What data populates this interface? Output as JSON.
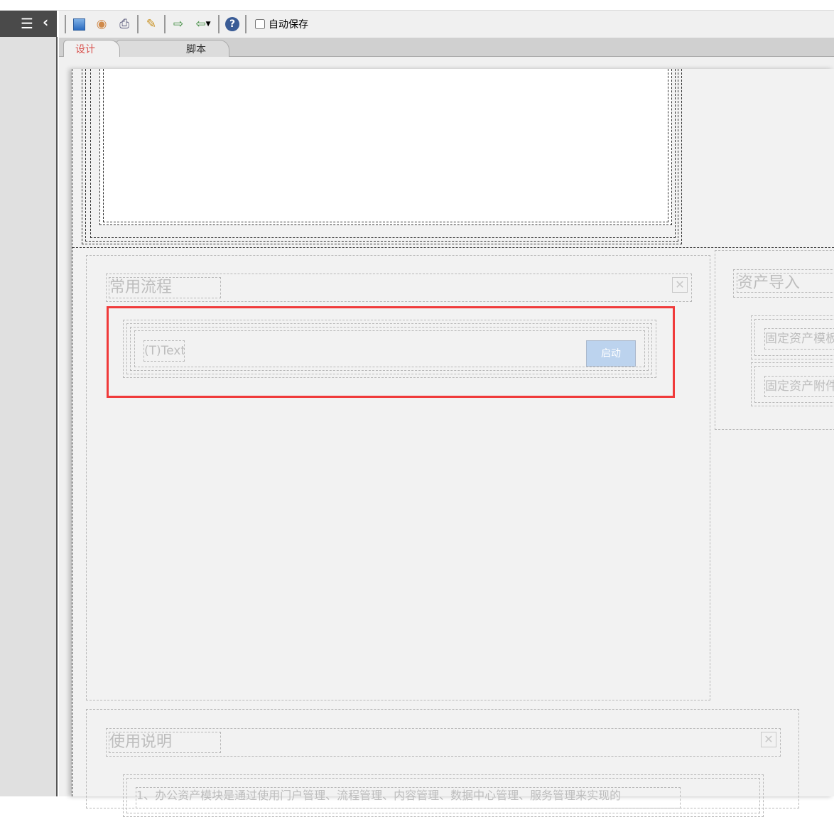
{
  "toolbar": {
    "icons": [
      "save-icon",
      "preview-icon",
      "print-icon",
      "wizard-icon",
      "export-icon",
      "import-icon",
      "help-icon"
    ],
    "autosave_label": "自动保存",
    "autosave_checked": false
  },
  "tabs": [
    {
      "label": "设计",
      "active": true
    },
    {
      "label": "脚本",
      "active": false
    }
  ],
  "panels": {
    "common_flow": {
      "title": "常用流程",
      "text_placeholder": "(T)Text",
      "start_button": "启动"
    },
    "asset_import": {
      "title": "资产导入",
      "items": [
        "固定资产模板",
        "固定资产附件"
      ]
    },
    "usage": {
      "title": "使用说明",
      "line1": "1、办公资产模块是通过使用门户管理、流程管理、内容管理、数据中心管理、服务管理来实现的"
    }
  },
  "colors": {
    "highlight": "#f03a3a",
    "button": "#bcd3ee",
    "tab_active_text": "#d9534f"
  }
}
